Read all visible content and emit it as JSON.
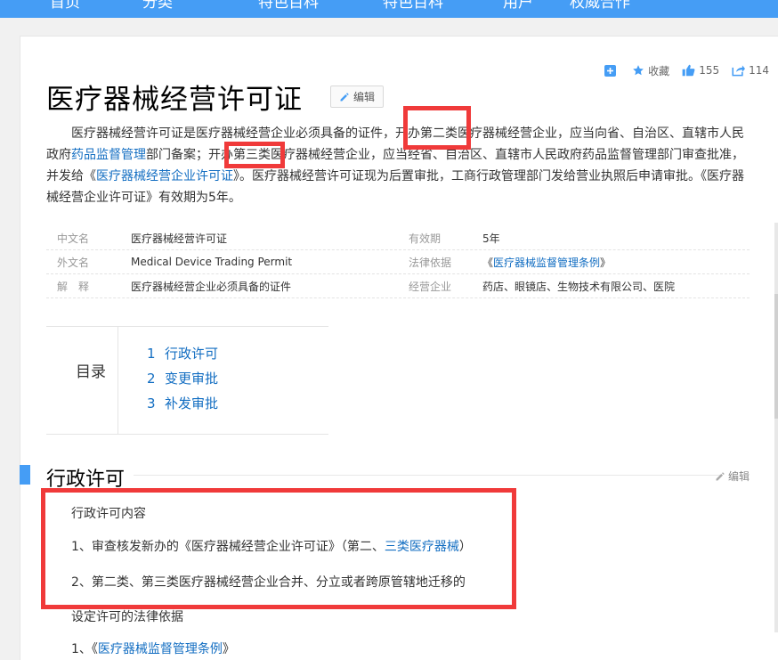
{
  "nav": {
    "items": [
      "首页",
      "分类",
      "特色百科",
      "特色百科",
      "用户",
      "权威合作"
    ]
  },
  "toolbar": {
    "add_label": "",
    "favorite_label": "收藏",
    "like_count": "155",
    "share_count": "114"
  },
  "article": {
    "title": "医疗器械经营许可证",
    "edit_label": "编辑",
    "summary": {
      "s1": "医疗器械经营许可证是医疗器械经营企业必须具备的证件，开办第二类医疗器械经营企业，应当向省、自治区、直辖市人民政府",
      "link1": "药品监督管理",
      "s2": "部门备案；开办第三类医疗器械经营企业，应当经省、自治区、直辖市人民政府药品监督管理部门审查批准，并发给《",
      "link2": "医疗器械经营企业许可证",
      "s3": "》。医疗器械经营许可证现为后置审批，工商行政管理部门发给营业执照后申请审批。《医疗器械经营企业许可证》有效期为5年。"
    }
  },
  "infobox": {
    "rows": [
      {
        "k": "中文名",
        "v": "医疗器械经营许可证",
        "k2": "有效期",
        "v2": "5年"
      },
      {
        "k": "外文名",
        "v": "Medical Device Trading Permit",
        "k2": "法律依据",
        "v2_pre": "《",
        "v2_link": "医疗器械监督管理条例",
        "v2_post": "》"
      },
      {
        "k": "解　释",
        "v": "医疗器械经营企业必须具备的证件",
        "k2": "经营企业",
        "v2": "药店、眼镜店、生物技术有限公司、医院"
      }
    ]
  },
  "toc": {
    "title": "目录",
    "items": [
      {
        "num": "1",
        "label": "行政许可"
      },
      {
        "num": "2",
        "label": "变更审批"
      },
      {
        "num": "3",
        "label": "补发审批"
      }
    ]
  },
  "section": {
    "title": "行政许可",
    "edit_label": "编辑",
    "p1": "行政许可内容",
    "p2_pre": "1、审查核发新办的《医疗器械经营企业许可证》（第二、",
    "p2_link": "三类医疗器械",
    "p2_post": "）",
    "p3": "2、第二类、第三类医疗器械经营企业合并、分立或者跨原管辖地迁移的",
    "p4": "设定许可的法律依据",
    "p5_pre": "1、《",
    "p5_link": "医疗器械监督管理条例",
    "p5_post": "》"
  },
  "colors": {
    "accent": "#459df5",
    "link": "#136ec2",
    "annotation": "#f03a3a"
  }
}
